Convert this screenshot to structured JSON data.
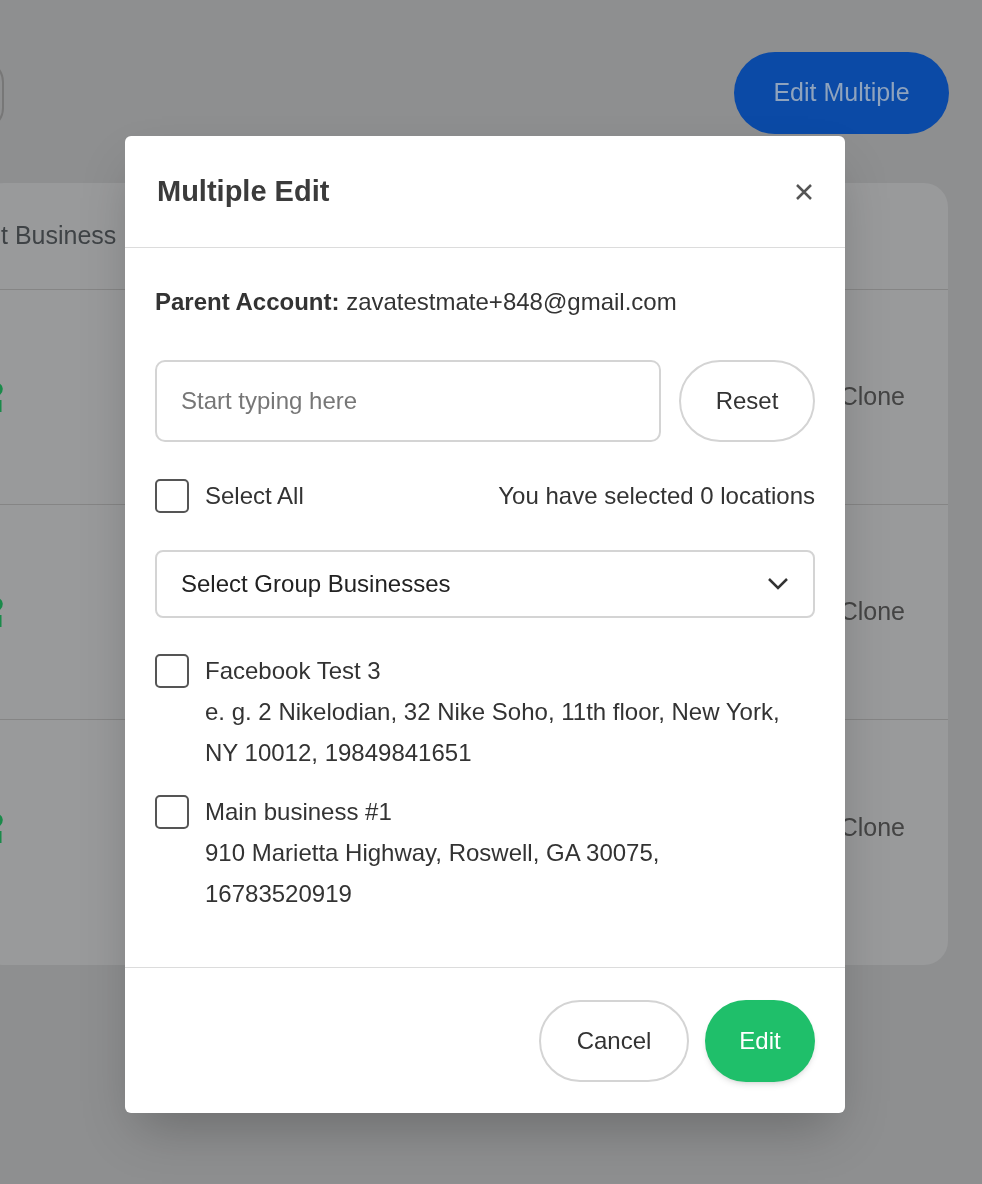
{
  "background": {
    "edit_multiple_button": "Edit Multiple",
    "table_header": "t Business",
    "rows": [
      {
        "action": "Clone"
      },
      {
        "action": "Clone"
      },
      {
        "action": "Clone"
      }
    ]
  },
  "modal": {
    "title": "Multiple Edit",
    "parent_account": "**Parent Account:** zavatestmate+848@gmail.com",
    "search": {
      "placeholder": "Start typing here"
    },
    "reset_button": "Reset",
    "select_all": {
      "label": "Select All",
      "checked": false
    },
    "selection_count": "You have selected 0 locations",
    "group_select": {
      "value": "Select Group Businesses"
    },
    "locations": [
      {
        "name": "Facebook Test 3",
        "address": "e. g. 2 Nikelodian, 32 Nike Soho, 11th floor, New York, NY 10012, 19849841651",
        "checked": false
      },
      {
        "name": "Main business #1",
        "address": "910 Marietta Highway, Roswell, GA 30075, 16783520919",
        "checked": false
      }
    ],
    "buttons": {
      "cancel": "Cancel",
      "edit": "Edit"
    }
  }
}
